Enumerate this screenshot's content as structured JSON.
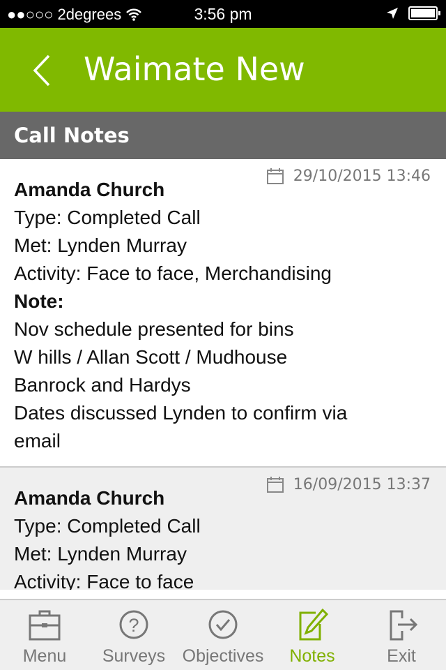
{
  "status_bar": {
    "carrier": "2degrees",
    "signal": "●●○○○",
    "time": "3:56 pm"
  },
  "header": {
    "title": "Waimate New"
  },
  "section": {
    "title": "Call Notes"
  },
  "notes": [
    {
      "date": "29/10/2015 13:46",
      "name": "Amanda Church",
      "type": "Type: Completed Call",
      "met": "Met: Lynden Murray",
      "activity": "Activity: Face to face, Merchandising",
      "note_label": "Note:",
      "lines": [
        "Nov schedule presented for bins",
        "W hills / Allan Scott / Mudhouse",
        "Banrock and Hardys",
        "Dates discussed Lynden to confirm via",
        "email"
      ]
    },
    {
      "date": "16/09/2015 13:37",
      "name": "Amanda Church",
      "type": "Type: Completed Call",
      "met": "Met: Lynden Murray",
      "activity": "Activity: Face to face"
    }
  ],
  "tabs": [
    {
      "label": "Menu",
      "icon": "briefcase-icon"
    },
    {
      "label": "Surveys",
      "icon": "question-icon"
    },
    {
      "label": "Objectives",
      "icon": "check-circle-icon"
    },
    {
      "label": "Notes",
      "icon": "edit-icon",
      "active": true
    },
    {
      "label": "Exit",
      "icon": "exit-icon"
    }
  ],
  "colors": {
    "brand": "#80b900",
    "subheader": "#686868"
  }
}
